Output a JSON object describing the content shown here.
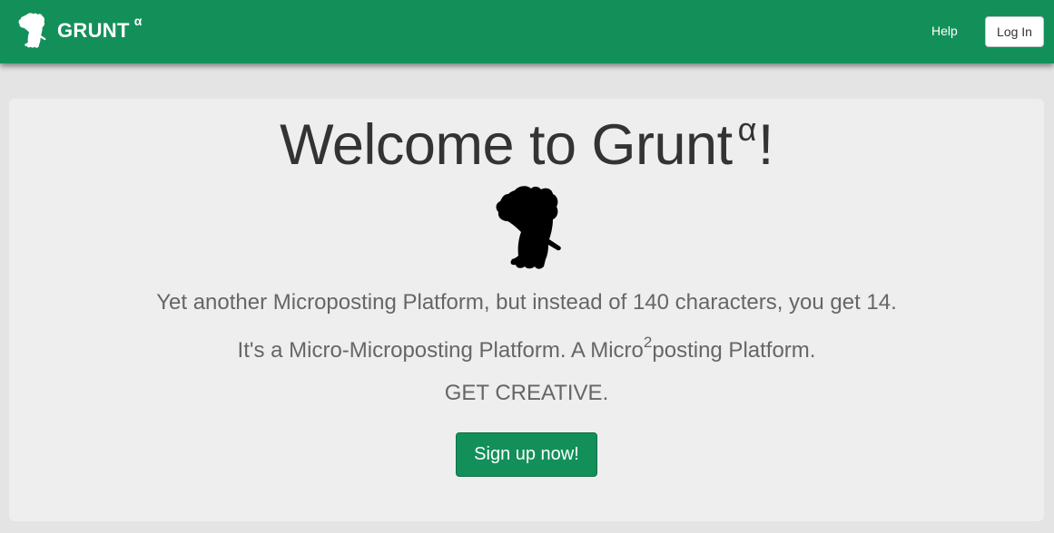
{
  "colors": {
    "brand_green": "#13905a",
    "page_background": "#e4e4e4",
    "panel_background": "#eeeeee",
    "heading_text": "#333333",
    "body_text": "#666666"
  },
  "navbar": {
    "brand_name": "GRUNT",
    "brand_superscript": "α",
    "logo_icon": "elephant-silhouette-icon",
    "help_link": "Help",
    "login_button": "Log In"
  },
  "hero": {
    "title_prefix": "Welcome to Grunt",
    "title_superscript": "α",
    "title_suffix": "!",
    "mascot_icon": "elephant-silhouette-icon",
    "line1": "Yet another Microposting Platform, but instead of 140 characters, you get 14.",
    "line2_prefix": "It's a Micro-Microposting Platform. A Micro",
    "line2_superscript": "2",
    "line2_suffix": "posting Platform.",
    "line3": "GET CREATIVE.",
    "cta_button": "Sign up now!"
  }
}
